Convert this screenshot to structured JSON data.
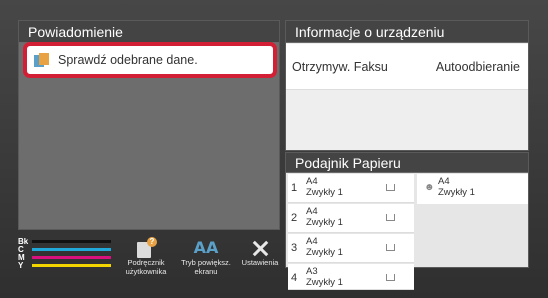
{
  "notifications": {
    "title": "Powiadomienie",
    "items": [
      {
        "text": "Sprawdź odebrane dane.",
        "icon": "received-data-icon"
      }
    ]
  },
  "device_info": {
    "title": "Informacje o urządzeniu",
    "rows": [
      {
        "label": "Otrzymyw. Faksu",
        "value": "Autoodbieranie"
      }
    ]
  },
  "paper_tray": {
    "title": "Podajnik Papieru",
    "trays": [
      {
        "number": "1",
        "size": "A4",
        "type": "Zwykły 1"
      },
      {
        "number": "2",
        "size": "A4",
        "type": "Zwykły 1"
      },
      {
        "number": "3",
        "size": "A4",
        "type": "Zwykły 1"
      },
      {
        "number": "4",
        "size": "A3",
        "type": "Zwykły 1"
      }
    ],
    "bypass": {
      "size": "A4",
      "type": "Zwykły 1"
    }
  },
  "toner": [
    {
      "label": "Bk",
      "color": "#111111",
      "level": 1.0
    },
    {
      "label": "C",
      "color": "#1fa8d8",
      "level": 1.0
    },
    {
      "label": "M",
      "color": "#d9117e",
      "level": 1.0
    },
    {
      "label": "Y",
      "color": "#f1d400",
      "level": 1.0
    }
  ],
  "buttons": {
    "manual": {
      "label_line1": "Podręcznik",
      "label_line2": "użytkownika"
    },
    "zoom": {
      "label_line1": "Tryb powiększ.",
      "label_line2": "ekranu",
      "glyph": "AA"
    },
    "settings": {
      "label": "Ustawienia"
    }
  },
  "colors": {
    "highlight": "#d31f36",
    "panel_header": "#444444"
  }
}
